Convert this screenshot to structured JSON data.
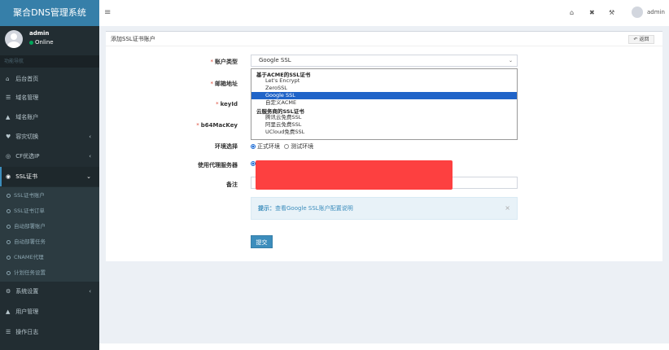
{
  "app": {
    "title": "聚合DNS管理系统"
  },
  "user": {
    "name": "admin",
    "status": "Online"
  },
  "sidebar": {
    "header": "功能导航",
    "items": [
      {
        "label": "后台首页",
        "icon": "home-icon",
        "glyph": "⌂"
      },
      {
        "label": "域名管理",
        "icon": "list-icon",
        "glyph": "☰"
      },
      {
        "label": "域名账户",
        "icon": "lock-icon",
        "glyph": "▲"
      },
      {
        "label": "容灾切换",
        "icon": "heart-icon",
        "glyph": "♥"
      },
      {
        "label": "CF优选IP",
        "icon": "globe-icon",
        "glyph": "◎"
      },
      {
        "label": "SSL证书",
        "icon": "globe-icon",
        "glyph": "◉"
      },
      {
        "label": "系统设置",
        "icon": "gear-icon",
        "glyph": "⚙"
      },
      {
        "label": "用户管理",
        "icon": "user-icon",
        "glyph": "▲"
      },
      {
        "label": "操作日志",
        "icon": "list-icon",
        "glyph": "☰"
      }
    ],
    "ssl_sub": [
      "SSL证书账户",
      "SSL证书订单",
      "自动部署账户",
      "自动部署任务",
      "CNAME代理",
      "计划任务设置"
    ]
  },
  "topbar": {
    "user": "admin"
  },
  "form": {
    "title": "添加SSL证书账户",
    "back_label": "返回",
    "labels": {
      "account_type": "账户类型",
      "email": "邮箱地址",
      "keyid": "keyId",
      "b64mackey": "b64MacKey",
      "env": "环境选择",
      "proxy": "使用代理服务器",
      "remark": "备注"
    },
    "account_type_value": "Google SSL",
    "dropdown": {
      "group1": "基于ACME的SSL证书",
      "group1_options": [
        "Let's Encrypt",
        "ZeroSSL",
        "Google SSL",
        "自定义ACME"
      ],
      "group2": "云服务商的SSL证书",
      "group2_options": [
        "腾讯云免费SSL",
        "阿里云免费SSL",
        "UCloud免费SSL"
      ],
      "selected": "Google SSL"
    },
    "env_options": [
      "正式环境",
      "测试环境"
    ],
    "alert_label": "提示：",
    "alert_link": "查看Google SSL账户配置说明",
    "submit_label": "提交"
  },
  "colors": {
    "sidebar_bg": "#222d32",
    "logo_bg": "#367fa9",
    "accent": "#3c8dbc",
    "selected_option": "#2064c8",
    "redaction": "#fd4040"
  }
}
